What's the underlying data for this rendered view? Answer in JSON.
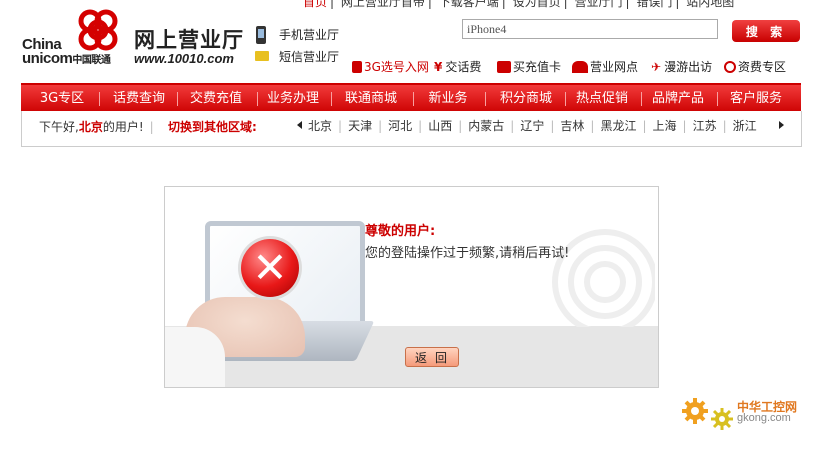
{
  "top_links": {
    "home": "首页",
    "items": [
      "网上营业厅首带",
      "下载客户端",
      "设为首页",
      "营业厅门",
      "错误门",
      "站内地图"
    ]
  },
  "logo": {
    "brand_en_1": "China",
    "brand_en_2": "unicom",
    "brand_cn": "中国联通",
    "title": "网上营业厅",
    "url": "www.10010.com"
  },
  "side_links": {
    "mobile": "手机营业厅",
    "sms": "短信营业厅"
  },
  "search": {
    "value": "iPhone4",
    "button_label": "搜 索"
  },
  "quick_links": [
    {
      "label": "3G选号入网",
      "icon": "phone-icon",
      "red": true
    },
    {
      "label": "交话费",
      "icon": "yen-icon",
      "red": false
    },
    {
      "label": "买充值卡",
      "icon": "card-icon",
      "red": false
    },
    {
      "label": "营业网点",
      "icon": "people-icon",
      "red": false
    },
    {
      "label": "漫游出访",
      "icon": "plane-icon",
      "red": false
    },
    {
      "label": "资费专区",
      "icon": "tariff-icon",
      "red": false
    }
  ],
  "nav": [
    "3G专区",
    "话费查询",
    "交费充值",
    "业务办理",
    "联通商城",
    "新业务",
    "积分商城",
    "热点促销",
    "品牌产品",
    "客户服务"
  ],
  "region_bar": {
    "greeting_prefix": "下午好,",
    "city": "北京",
    "greeting_suffix": "的用户!",
    "switch_label": "切换到其他区域:",
    "regions": [
      "北京",
      "天津",
      "河北",
      "山西",
      "内蒙古",
      "辽宁",
      "吉林",
      "黑龙江",
      "上海",
      "江苏",
      "浙江"
    ]
  },
  "dialog": {
    "title": "尊敬的用户:",
    "message": "您的登陆操作过于频繁,请稍后再试!",
    "back_label": "返回"
  },
  "watermark": {
    "cn": "中华工控网",
    "en": "gkong.com"
  },
  "colors": {
    "brand_red": "#cc0000",
    "nav_bg": "#e21a1a",
    "dialog_bottom": "#e6e6e6"
  }
}
